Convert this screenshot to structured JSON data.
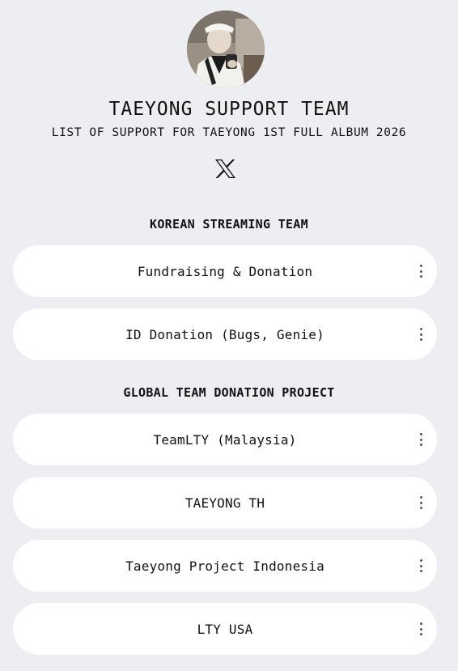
{
  "profile": {
    "avatar_icon": "profile-photo",
    "title": "TAEYONG SUPPORT TEAM",
    "subtitle": "LIST OF SUPPORT FOR TAEYONG 1ST FULL ALBUM 2026",
    "social_icon": "x-logo-icon"
  },
  "sections": [
    {
      "heading": "KOREAN STREAMING TEAM",
      "links": [
        {
          "label": "Fundraising & Donation"
        },
        {
          "label": "ID Donation (Bugs, Genie)"
        }
      ]
    },
    {
      "heading": "GLOBAL TEAM DONATION PROJECT",
      "links": [
        {
          "label": "TeamLTY (Malaysia)"
        },
        {
          "label": "TAEYONG TH"
        },
        {
          "label": "Taeyong Project Indonesia"
        },
        {
          "label": "LTY USA"
        }
      ]
    }
  ],
  "colors": {
    "background": "#eceef2",
    "card": "#ffffff",
    "text": "#111111"
  }
}
